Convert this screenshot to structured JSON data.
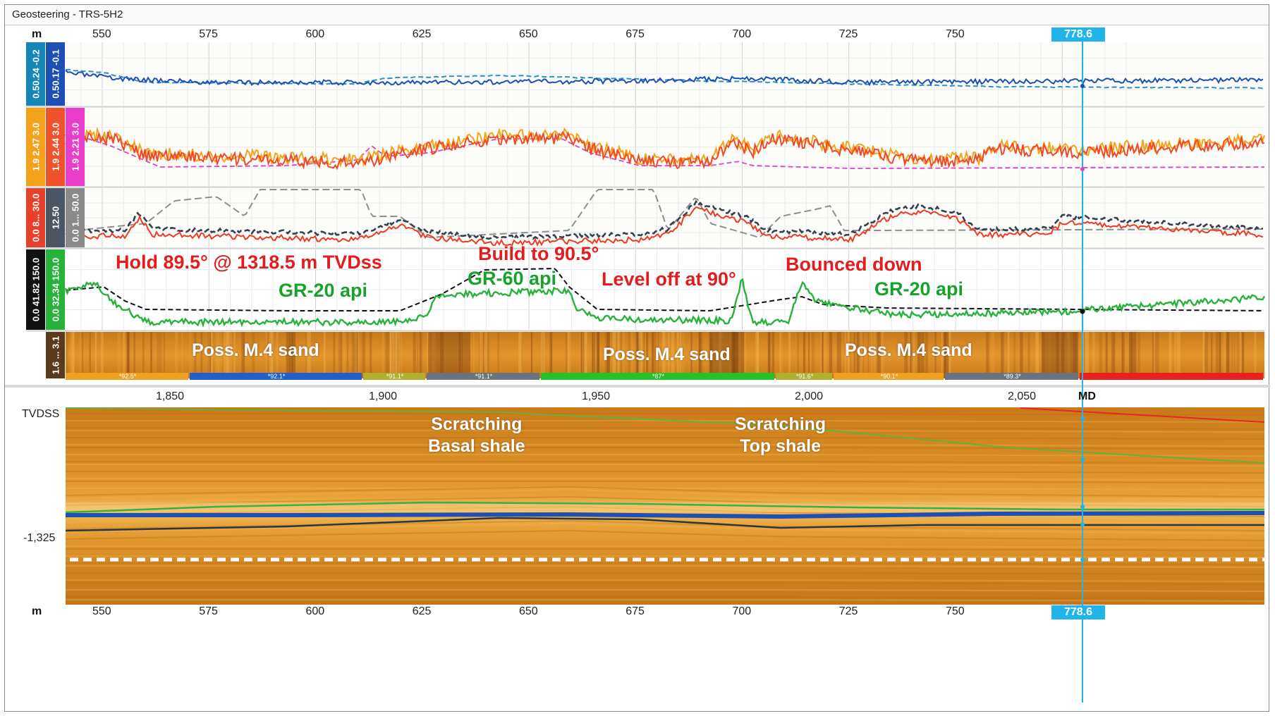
{
  "window": {
    "title": "Geosteering - TRS-5H2"
  },
  "top_axis": {
    "unit": "m",
    "ticks": [
      "550",
      "575",
      "600",
      "625",
      "650",
      "675",
      "700",
      "725",
      "750"
    ],
    "cursor_value": "778.6"
  },
  "bottom_axis": {
    "unit": "m",
    "ticks": [
      "550",
      "575",
      "600",
      "625",
      "650",
      "675",
      "700",
      "725",
      "750"
    ],
    "cursor_value": "778.6"
  },
  "md_axis": {
    "ticks": [
      "1,850",
      "1,900",
      "1,950",
      "2,000",
      "2,050"
    ],
    "end_label": "MD"
  },
  "section": {
    "y_label": "TVDSS",
    "y_tick": "-1,325"
  },
  "tracks": {
    "track1": {
      "chips": [
        {
          "text": "0.50.24 -0.2",
          "color": "#1686b8"
        },
        {
          "text": "0.50.17 -0.1",
          "color": "#1d4fb5"
        }
      ]
    },
    "track2": {
      "chips": [
        {
          "text": "1.9   2.47   3.0",
          "color": "#f5a21b"
        },
        {
          "text": "1.9   2.44   3.0",
          "color": "#f0522d"
        },
        {
          "text": "1.9   2.21   3.0",
          "color": "#e83ec9"
        }
      ]
    },
    "track3": {
      "chips": [
        {
          "text": "0.0 8... 30.0",
          "color": "#e8402b"
        },
        {
          "text": "12.50",
          "color": "#4a5566"
        },
        {
          "text": "0.0 1... 50.0",
          "color": "#8a8a8a"
        }
      ]
    },
    "track4": {
      "chips": [
        {
          "text": "0.0 41.82 150.0",
          "color": "#111111"
        },
        {
          "text": "0.0 32.34 150.0",
          "color": "#27b23a"
        }
      ]
    },
    "track5": {
      "chips": [
        {
          "text": "1.6 ... 3.1",
          "color": "#5a3a1a"
        }
      ]
    }
  },
  "dip_segments": [
    {
      "label": "*92.5*",
      "color": "#f0a020"
    },
    {
      "label": "*92.1*",
      "color": "#1f5fd0"
    },
    {
      "label": "*91.1*",
      "color": "#b0b030"
    },
    {
      "label": "*91.1*",
      "color": "#6b7280"
    },
    {
      "label": "*87*",
      "color": "#22c22a"
    },
    {
      "label": "*91.6*",
      "color": "#b0b030"
    },
    {
      "label": "*90.1*",
      "color": "#f0a020"
    },
    {
      "label": "*89.3*",
      "color": "#6b7280"
    },
    {
      "label": "",
      "color": "#e8201f"
    }
  ],
  "annotations": {
    "hold": "Hold  89.5° @ 1318.5 m TVDss",
    "build": "Build to 90.5°",
    "level": "Level off at 90°",
    "bounced": "Bounced down",
    "gr20_a": "GR-20 api",
    "gr60": "GR-60 api",
    "gr20_b": "GR-20 api",
    "sand_a": "Poss. M.4 sand",
    "sand_b": "Poss. M.4 sand",
    "sand_c": "Poss. M.4 sand",
    "basal": "Scratching\nBasal shale",
    "top": "Scratching\nTop shale"
  },
  "colors": {
    "accent": "#1fb5ec",
    "annotation_red": "#e31d1d",
    "annotation_green": "#17a32b"
  }
}
